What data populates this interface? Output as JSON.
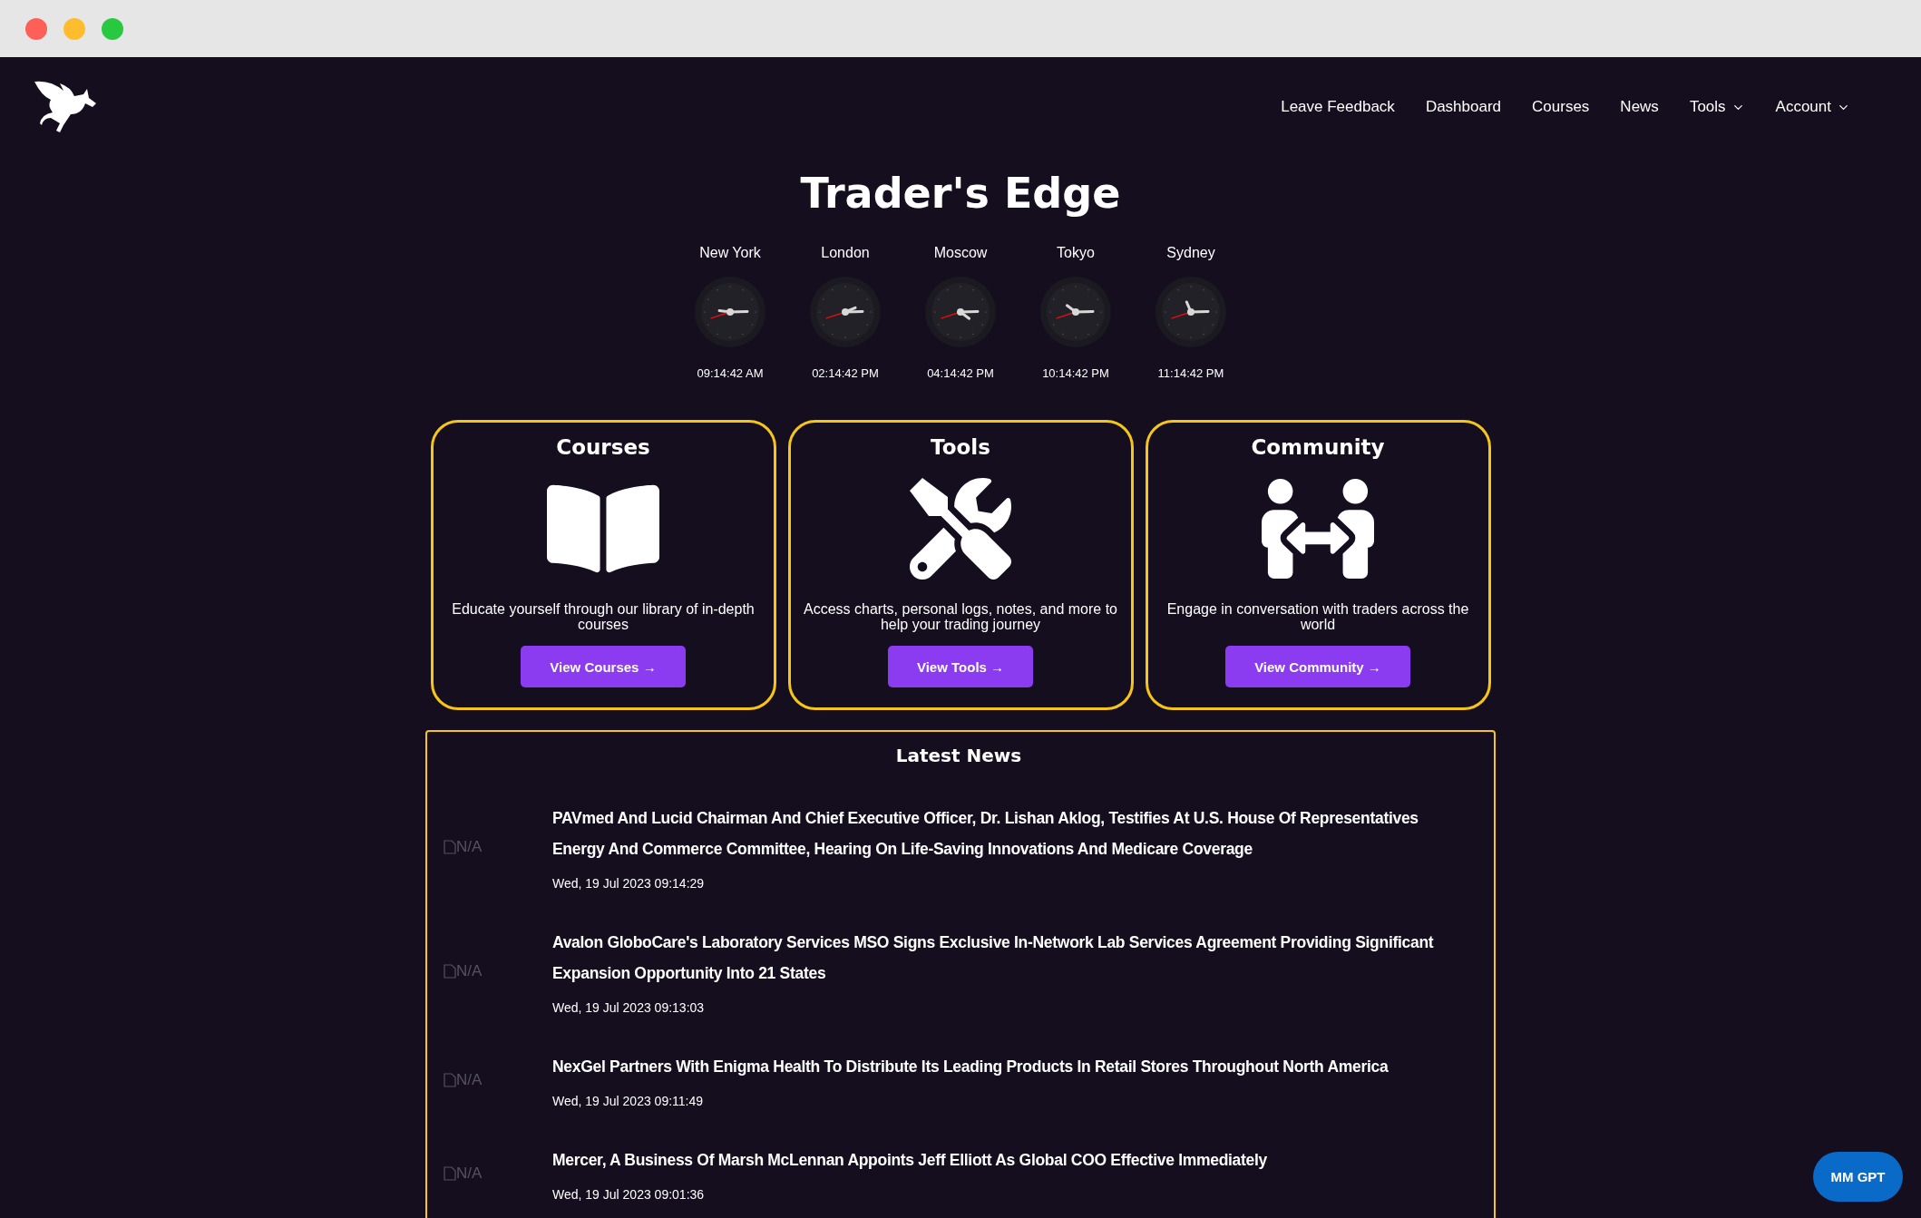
{
  "nav": {
    "items": [
      {
        "label": "Leave Feedback",
        "dropdown": false
      },
      {
        "label": "Dashboard",
        "dropdown": false
      },
      {
        "label": "Courses",
        "dropdown": false
      },
      {
        "label": "News",
        "dropdown": false
      },
      {
        "label": "Tools",
        "dropdown": true
      },
      {
        "label": "Account",
        "dropdown": true
      }
    ]
  },
  "title": "Trader's Edge",
  "clocks": [
    {
      "city": "New York",
      "time": "09:14:42 AM"
    },
    {
      "city": "London",
      "time": "02:14:42 PM"
    },
    {
      "city": "Moscow",
      "time": "04:14:42 PM"
    },
    {
      "city": "Tokyo",
      "time": "10:14:42 PM"
    },
    {
      "city": "Sydney",
      "time": "11:14:42 PM"
    }
  ],
  "cards": [
    {
      "kind": "book",
      "title": "Courses",
      "text": "Educate yourself through our library of in-depth courses",
      "button": "View Courses →"
    },
    {
      "kind": "tools",
      "title": "Tools",
      "text": "Access charts, personal logs, notes, and more to help your trading journey",
      "button": "View Tools →"
    },
    {
      "kind": "community",
      "title": "Community",
      "text": "Engage in conversation with traders across the world",
      "button": "View Community →"
    }
  ],
  "news": {
    "title": "Latest News",
    "items": [
      {
        "image_alt": "N/A",
        "headline": "PAVmed And Lucid Chairman And Chief Executive Officer, Dr. Lishan Aklog, Testifies At U.S. House Of Representatives Energy And Commerce Committee, Hearing On Life-Saving Innovations And Medicare Coverage",
        "date": "Wed, 19 Jul 2023 09:14:29"
      },
      {
        "image_alt": "N/A",
        "headline": "Avalon GloboCare's Laboratory Services MSO Signs Exclusive In-Network Lab Services Agreement Providing Significant Expansion Opportunity Into 21 States",
        "date": "Wed, 19 Jul 2023 09:13:03"
      },
      {
        "image_alt": "N/A",
        "headline": "NexGel Partners With Enigma Health To Distribute Its Leading Products In Retail Stores Throughout North America",
        "date": "Wed, 19 Jul 2023 09:11:49"
      },
      {
        "image_alt": "N/A",
        "headline": "Mercer, A Business Of Marsh McLennan Appoints Jeff Elliott As Global COO Effective Immediately",
        "date": "Wed, 19 Jul 2023 09:01:36"
      }
    ]
  },
  "chat_button": "MM GPT"
}
